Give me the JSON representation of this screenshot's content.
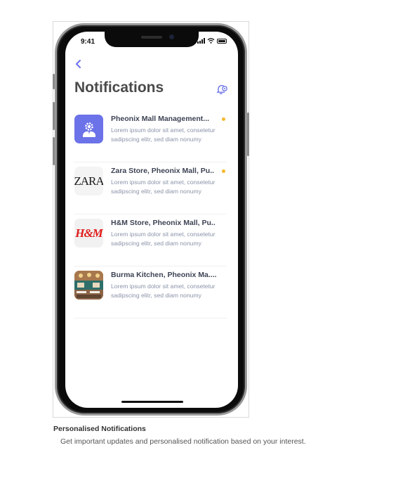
{
  "status_bar": {
    "time": "9:41"
  },
  "header": {
    "title": "Notifications"
  },
  "notifications": [
    {
      "title": "Pheonix Mall Management...",
      "body": "Lorem ipsum dolor sit amet, consetetur sadipscing elitr, sed diam nonumy",
      "thumbnail": "mall-management-icon",
      "unread": true
    },
    {
      "title": "Zara Store, Pheonix Mall, Pu..",
      "body": "Lorem ipsum dolor sit amet, consetetur sadipscing elitr, sed diam nonumy",
      "thumbnail": "zara-logo",
      "logo_text": "ZARA",
      "unread": true
    },
    {
      "title": "H&M Store, Pheonix Mall, Pu..",
      "body": "Lorem ipsum dolor sit amet, consetetur sadipscing elitr, sed diam nonumy",
      "thumbnail": "hm-logo",
      "logo_text": "H&M",
      "unread": false
    },
    {
      "title": "Burma Kitchen, Pheonix Ma....",
      "body": "Lorem ipsum dolor sit amet, consetetur sadipscing elitr, sed diam nonumy",
      "thumbnail": "restaurant-photo",
      "unread": false
    }
  ],
  "caption": {
    "title": "Personalised Notifications",
    "description": "Get important updates and personalised notification based on your interest."
  },
  "colors": {
    "accent": "#6c72e8",
    "unread_dot": "#f5b82e",
    "title_text": "#4a4a4a",
    "body_text": "#8a93a8"
  },
  "icons": {
    "back": "chevron-left-icon",
    "settings": "notification-settings-icon"
  }
}
